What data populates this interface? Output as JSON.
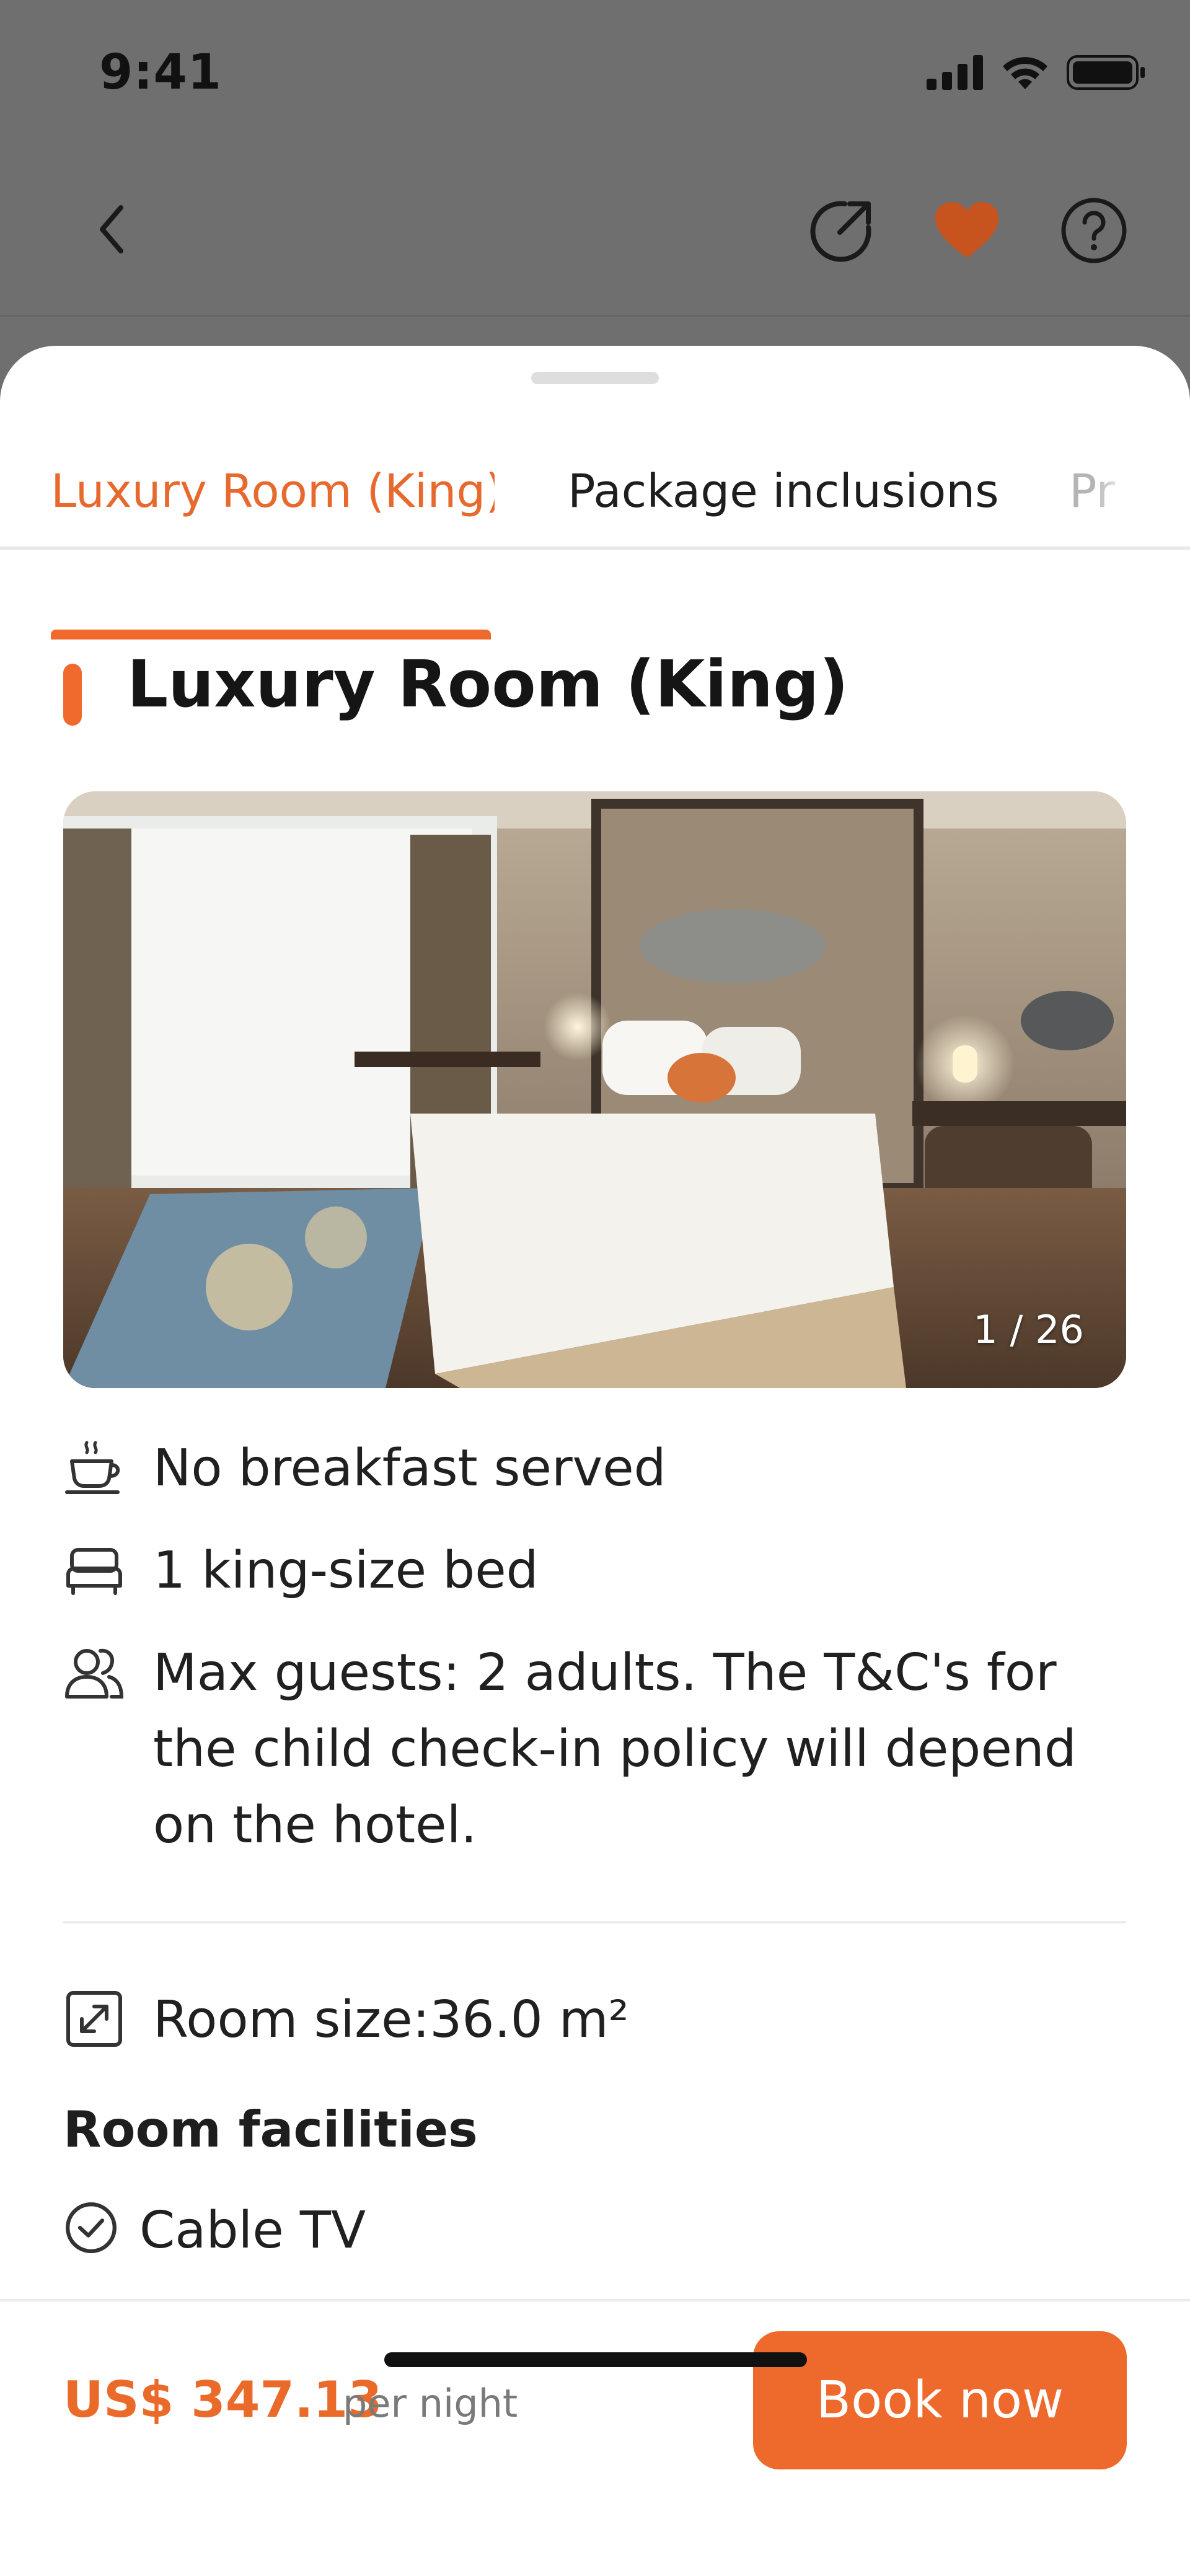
{
  "status_bar": {
    "time": "9:41",
    "icons": [
      "signal-icon",
      "wifi-icon",
      "battery-icon"
    ]
  },
  "nav": {
    "icons": [
      "back-icon",
      "share-icon",
      "heart-icon",
      "help-icon"
    ],
    "favorite_color": "#c7531f"
  },
  "tabs": [
    {
      "label": "Luxury Room (King)",
      "active": true
    },
    {
      "label": "Package inclusions",
      "active": false
    },
    {
      "label": "Pr",
      "active": false
    }
  ],
  "room": {
    "title": "Luxury Room (King)",
    "photo_counter": "1 / 26",
    "features": [
      {
        "icon": "coffee-cup-icon",
        "text": "No breakfast served"
      },
      {
        "icon": "bed-icon",
        "text": "1 king-size bed"
      },
      {
        "icon": "guests-icon",
        "text": "Max guests: 2 adults. The T&C's for the child check-in policy will depend on the hotel."
      }
    ],
    "size": {
      "icon": "expand-icon",
      "text": "Room size:36.0 m²"
    }
  },
  "facilities": {
    "heading": "Room facilities",
    "items": [
      {
        "icon": "check-circle-icon",
        "text": "Cable TV"
      }
    ]
  },
  "booking": {
    "price": "US$ 347.13",
    "per_night": "per night",
    "button": "Book now"
  },
  "colors": {
    "accent": "#ee6a2c",
    "text": "#1e1e1e",
    "overlay": "#6f6f6f"
  }
}
